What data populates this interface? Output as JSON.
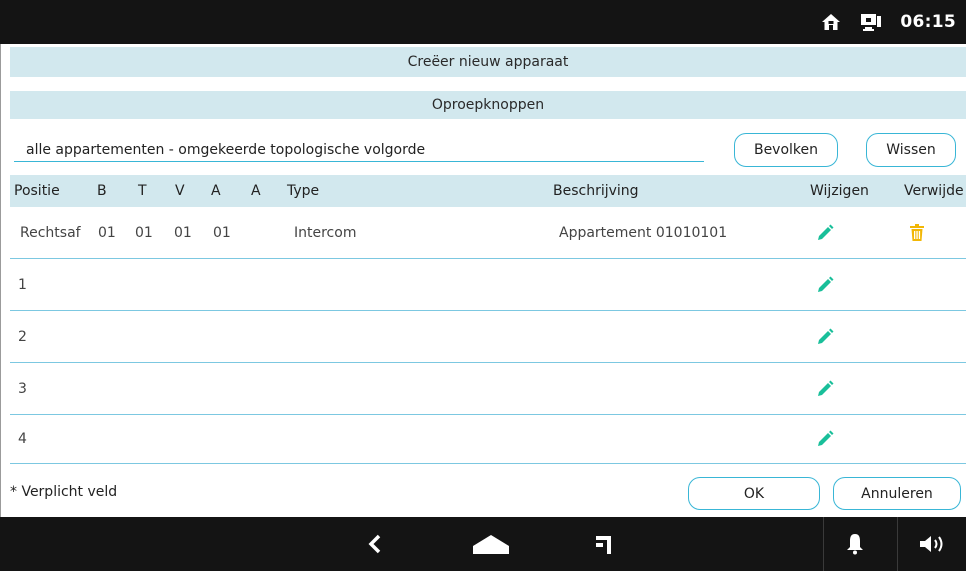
{
  "statusbar": {
    "time": "06:15",
    "icons": [
      "home-icon",
      "monitor-icon"
    ]
  },
  "dialog": {
    "title": "Creëer nieuw apparaat",
    "section": "Oproepknoppen",
    "filter_value": "alle appartementen - omgekeerde topologische volgorde",
    "populate_label": "Bevolken",
    "clear_label": "Wissen"
  },
  "table": {
    "headers": {
      "position": "Positie",
      "b": "B",
      "t": "T",
      "v": "V",
      "a1": "A",
      "a2": "A",
      "type": "Type",
      "description": "Beschrijving",
      "edit": "Wijzigen",
      "delete": "Verwijde"
    },
    "rows": [
      {
        "position": "Rechtsaf",
        "b": "01",
        "t": "01",
        "v": "01",
        "a1": "01",
        "a2": "",
        "type": "Intercom",
        "description": "Appartement 01010101",
        "edit_icon": "pencil-icon",
        "delete_icon": "trash-icon"
      },
      {
        "position": "1",
        "b": "",
        "t": "",
        "v": "",
        "a1": "",
        "a2": "",
        "type": "",
        "description": "",
        "edit_icon": "pencil-icon",
        "delete_icon": ""
      },
      {
        "position": "2",
        "b": "",
        "t": "",
        "v": "",
        "a1": "",
        "a2": "",
        "type": "",
        "description": "",
        "edit_icon": "pencil-icon",
        "delete_icon": ""
      },
      {
        "position": "3",
        "b": "",
        "t": "",
        "v": "",
        "a1": "",
        "a2": "",
        "type": "",
        "description": "",
        "edit_icon": "pencil-icon",
        "delete_icon": ""
      },
      {
        "position": "4",
        "b": "",
        "t": "",
        "v": "",
        "a1": "",
        "a2": "",
        "type": "",
        "description": "",
        "edit_icon": "pencil-icon",
        "delete_icon": ""
      }
    ]
  },
  "footer": {
    "required_note": "* Verplicht veld",
    "ok_label": "OK",
    "cancel_label": "Annuleren"
  },
  "navbar": {
    "icons": [
      "back-icon",
      "home-icon",
      "recent-apps-icon",
      "bell-icon",
      "volume-icon"
    ]
  },
  "colors": {
    "accent": "#39b6d6",
    "header_bg": "#d2e8ee",
    "edit_icon": "#19bf9a",
    "delete_icon": "#f2b705",
    "bar_bg": "#141414"
  }
}
